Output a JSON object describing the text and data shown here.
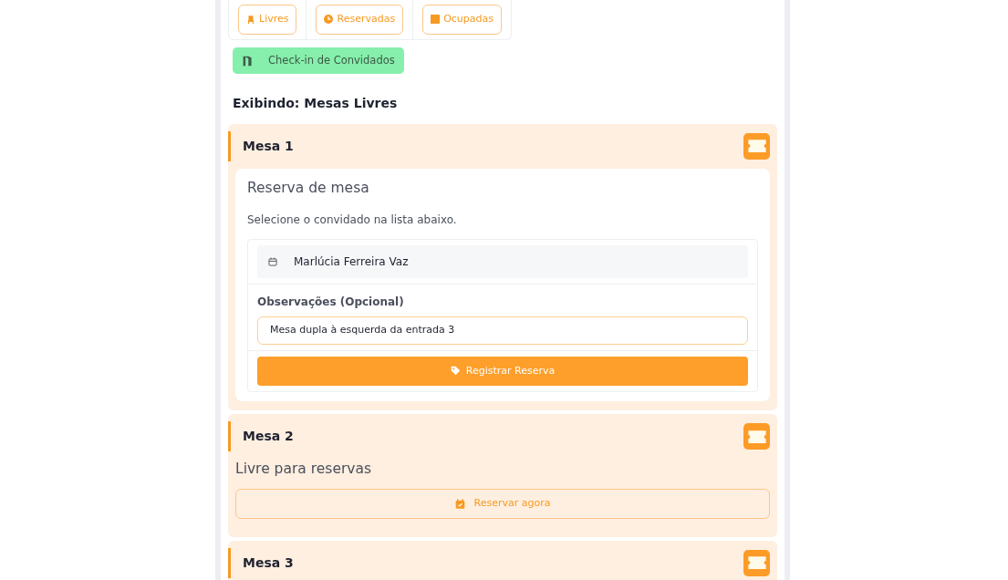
{
  "filters": [
    {
      "label": "Livres"
    },
    {
      "label": "Reservadas"
    },
    {
      "label": "Ocupadas"
    }
  ],
  "checkin_button": "Check-in de Convidados",
  "heading": "Exibindo: Mesas Livres",
  "tables": [
    {
      "kind": "form",
      "title": "Mesa 1",
      "form": {
        "title": "Reserva de mesa",
        "hint": "Selecione o convidado na lista abaixo.",
        "guest": "Marlúcia Ferreira Vaz",
        "notes_label": "Observações (Opcional)",
        "notes_value": "Mesa dupla à esquerda da entrada 3",
        "submit": "Registrar Reserva"
      }
    },
    {
      "kind": "free",
      "title": "Mesa 2",
      "status": "Livre para reservas",
      "action": "Reservar agora"
    },
    {
      "kind": "free",
      "title": "Mesa 3"
    }
  ]
}
